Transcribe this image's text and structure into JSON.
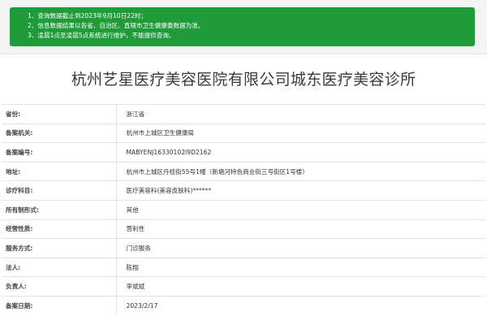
{
  "notice": {
    "lines": [
      "1、查询数据截止到2023年9月10日22时；",
      "2、信息数据结果以各省、自治区、直辖市卫生健康委数据为准。",
      "3、凌晨1点至凌晨5点系统进行维护，不能提供查询。"
    ],
    "background": "#1f9b3a"
  },
  "record": {
    "title": "杭州艺星医疗美容医院有限公司城东医疗美容诊所",
    "fields": [
      {
        "label": "省份:",
        "value": "浙江省"
      },
      {
        "label": "备案机关:",
        "value": "杭州市上城区卫生健康局"
      },
      {
        "label": "备案编号:",
        "value": "MABYENJ16330102I9D2162"
      },
      {
        "label": "地址:",
        "value": "杭州市上城区丹桂街55号1幢（新塘河特色商业街三号街区1号楼）"
      },
      {
        "label": "诊疗科目:",
        "value": "医疗美容科(美容皮肤科)******"
      },
      {
        "label": "所有制形式:",
        "value": "其他"
      },
      {
        "label": "经营性质:",
        "value": "营利性"
      },
      {
        "label": "服务方式:",
        "value": "门诊服务"
      },
      {
        "label": "法人:",
        "value": "陈翔"
      },
      {
        "label": "负责人:",
        "value": "李斌斌"
      },
      {
        "label": "备案日期:",
        "value": "2023/2/17"
      }
    ]
  }
}
